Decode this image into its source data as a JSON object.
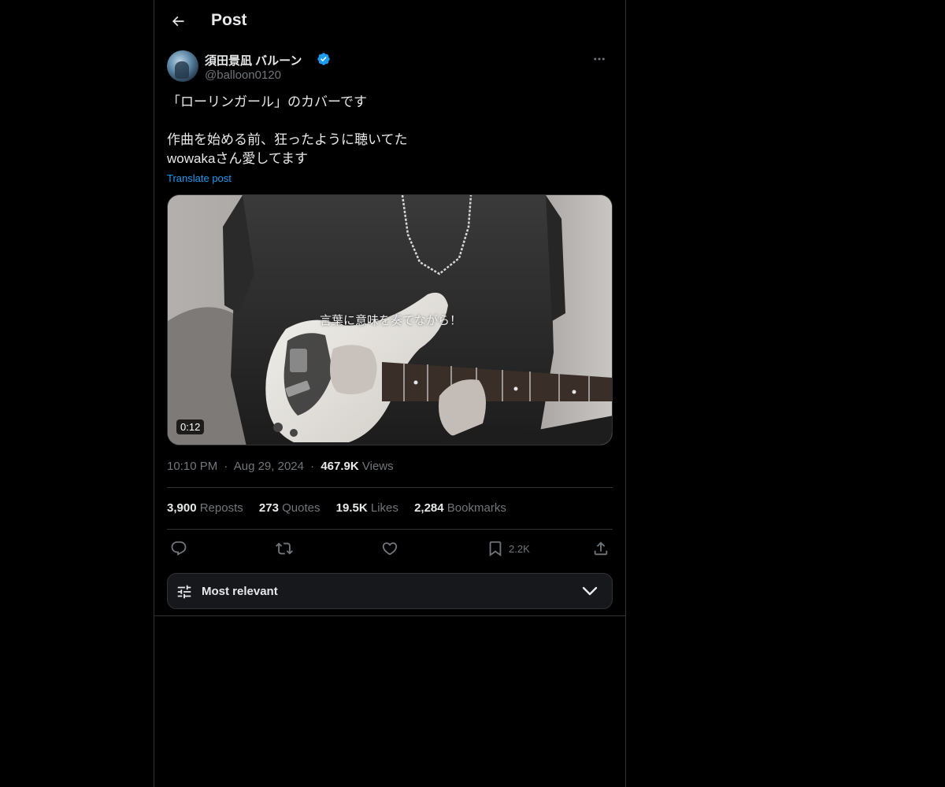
{
  "header": {
    "title": "Post"
  },
  "author": {
    "display_name": "須田景凪 バルーン",
    "handle": "@balloon0120",
    "verified": true
  },
  "post": {
    "lines": [
      "「ローリンガール」のカバーです",
      "",
      "作曲を始める前、狂ったように聴いてた",
      "wowakaさん愛してます"
    ],
    "translate_label": "Translate post"
  },
  "media": {
    "subtitle": "言葉に意味を奏でながら！",
    "duration": "0:12"
  },
  "meta": {
    "time": "10:10 PM",
    "separator": "·",
    "date": "Aug 29, 2024",
    "views_count": "467.9K",
    "views_label": "Views"
  },
  "stats": {
    "reposts_count": "3,900",
    "reposts_label": "Reposts",
    "quotes_count": "273",
    "quotes_label": "Quotes",
    "likes_count": "19.5K",
    "likes_label": "Likes",
    "bookmarks_count": "2,284",
    "bookmarks_label": "Bookmarks"
  },
  "actions": {
    "bookmark_count": "2.2K",
    "icons": [
      "reply-icon",
      "repost-icon",
      "like-icon",
      "bookmark-icon",
      "share-icon"
    ]
  },
  "sort": {
    "label": "Most relevant"
  },
  "colors": {
    "accent": "#1d9bf0",
    "background": "#000000",
    "text_primary": "#e7e9ea",
    "text_secondary": "#71767b",
    "border": "#2f3336"
  }
}
